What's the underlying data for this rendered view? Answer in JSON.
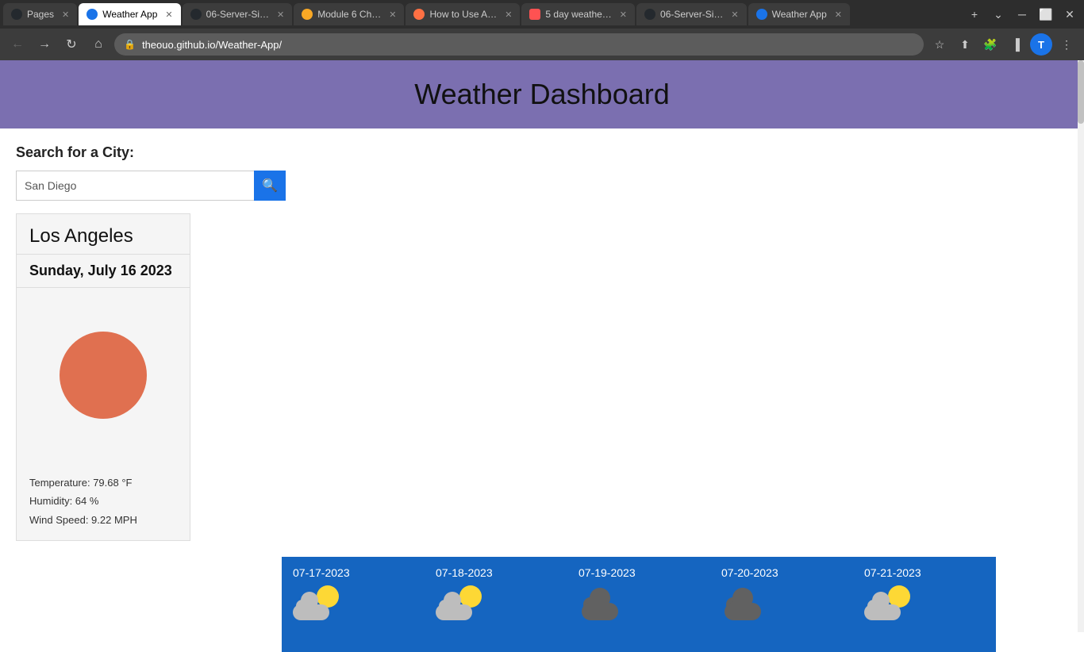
{
  "browser": {
    "tabs": [
      {
        "id": "pages",
        "label": "Pages",
        "icon_color": "#24292e",
        "icon_char": "⬤",
        "active": false
      },
      {
        "id": "weather-app",
        "label": "Weather App",
        "icon_color": "#1a73e8",
        "icon_char": "⬤",
        "active": true
      },
      {
        "id": "06-server-1",
        "label": "06-Server-Si…",
        "icon_color": "#24292e",
        "icon_char": "⬤",
        "active": false
      },
      {
        "id": "module6",
        "label": "Module 6 Ch…",
        "icon_color": "#F9A825",
        "icon_char": "⬤",
        "active": false
      },
      {
        "id": "how-to-use",
        "label": "How to Use A…",
        "icon_color": "#FF7043",
        "icon_char": "⬤",
        "active": false
      },
      {
        "id": "5day",
        "label": "5 day weathe…",
        "icon_color": "#FF5252",
        "icon_char": "⬤",
        "active": false
      },
      {
        "id": "06-server-2",
        "label": "06-Server-Si…",
        "icon_color": "#24292e",
        "icon_char": "⬤",
        "active": false
      },
      {
        "id": "weather-app-2",
        "label": "Weather App",
        "icon_color": "#1a73e8",
        "icon_char": "⬤",
        "active": false
      }
    ],
    "address": "theouo.github.io/Weather-App/",
    "new_tab_label": "+",
    "profile_initial": "T"
  },
  "page": {
    "header_title": "Weather Dashboard",
    "search_label": "Search for a City:",
    "search_placeholder": "San Diego",
    "search_btn_icon": "🔍",
    "current": {
      "city": "Los Angeles",
      "date": "Sunday, July 16 2023",
      "temperature": "Temperature: 79.68 °F",
      "humidity": "Humidity: 64 %",
      "wind_speed": "Wind Speed: 9.22 MPH"
    },
    "forecast": [
      {
        "date": "07-17-2023",
        "icon_type": "sun-cloud"
      },
      {
        "date": "07-18-2023",
        "icon_type": "sun-cloud"
      },
      {
        "date": "07-19-2023",
        "icon_type": "dark-cloud"
      },
      {
        "date": "07-20-2023",
        "icon_type": "dark-cloud"
      },
      {
        "date": "07-21-2023",
        "icon_type": "sun-cloud"
      }
    ]
  },
  "colors": {
    "header_bg": "#7B6FB0",
    "forecast_bg": "#1565C0",
    "search_btn": "#1a73e8"
  }
}
